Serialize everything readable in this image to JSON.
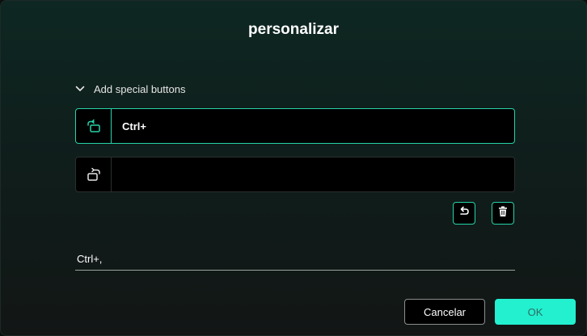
{
  "dialog": {
    "title": "personalizar"
  },
  "section": {
    "label": "Add special buttons",
    "icon": "chevron-down-icon",
    "expanded": true
  },
  "rows": [
    {
      "icon": "rotate-ccw-screen-icon",
      "value": "Ctrl+",
      "active": true
    },
    {
      "icon": "rotate-cw-screen-icon",
      "value": "",
      "active": false
    }
  ],
  "actions": {
    "undo_icon": "undo-icon",
    "delete_icon": "trash-icon"
  },
  "preview": {
    "value": "Ctrl+,"
  },
  "buttons": {
    "cancel_label": "Cancelar",
    "ok_label": "OK"
  },
  "colors": {
    "accent": "#27d3a8",
    "ok_bg": "#22f0cf",
    "ok_text": "#2f6d62"
  }
}
